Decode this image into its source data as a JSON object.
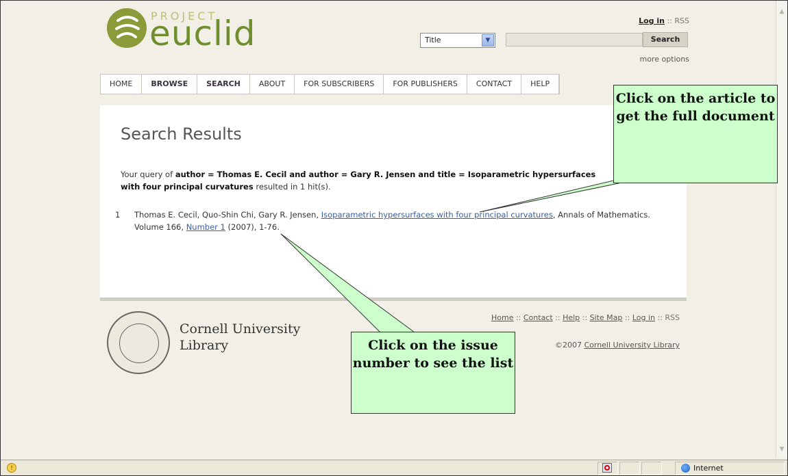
{
  "header": {
    "logo_project": "PROJECT",
    "logo_euclid": "euclid",
    "login": "Log in",
    "sep": " :: ",
    "rss": "RSS",
    "search_field_select": "Title",
    "search_button": "Search",
    "more_options": "more options"
  },
  "nav": [
    {
      "label": "HOME"
    },
    {
      "label": "BROWSE"
    },
    {
      "label": "SEARCH"
    },
    {
      "label": "ABOUT"
    },
    {
      "label": "FOR SUBSCRIBERS"
    },
    {
      "label": "FOR PUBLISHERS"
    },
    {
      "label": "CONTACT"
    },
    {
      "label": "HELP"
    }
  ],
  "main": {
    "title": "Search Results",
    "query_prefix": "Your query of ",
    "query_bold_1": "author = Thomas E. Cecil and author = Gary R. Jensen and title = Isoparametric hypersurfaces",
    "query_bold_2": "with four principal curvatures",
    "query_suffix": " resulted in 1 hit(s).",
    "result": {
      "number": "1",
      "authors": "Thomas E. Cecil, Quo-Shin Chi, Gary R. Jensen, ",
      "title_link": "Isoparametric hypersurfaces with four principal curvatures",
      "journal": ", Annals of Mathematics. Volume 166, ",
      "issue_link": "Number 1",
      "tail": " (2007), 1-76."
    }
  },
  "footer": {
    "library_name_1": "Cornell University",
    "library_name_2": "Library",
    "links": [
      "Home",
      "Contact",
      "Help",
      "Site Map",
      "Log in"
    ],
    "rss": "RSS",
    "copyright_prefix": "©2007 ",
    "copyright_link": "Cornell University Library"
  },
  "callouts": {
    "article": "Click on the article to get the full document",
    "issue": "Click on the issue number to see the list"
  },
  "statusbar": {
    "zone": "Internet"
  }
}
